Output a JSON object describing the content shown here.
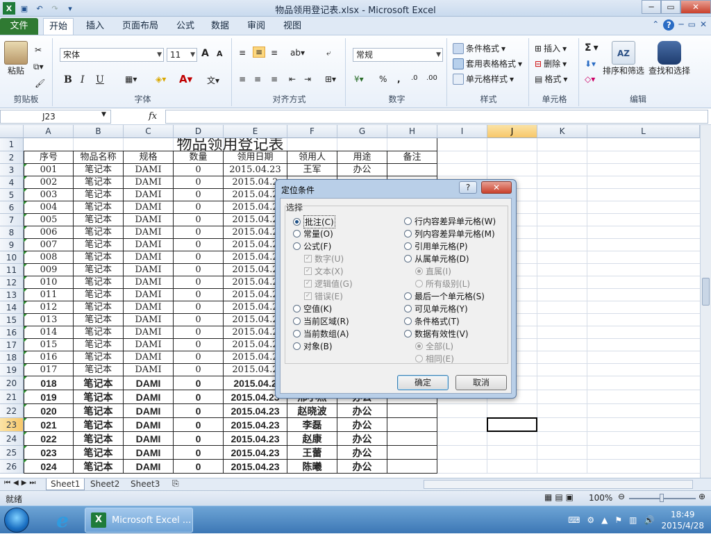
{
  "window": {
    "title": "物品领用登记表.xlsx - Microsoft Excel",
    "min": "─",
    "max": "▭",
    "close": "✕"
  },
  "tabs": [
    "文件",
    "开始",
    "插入",
    "页面布局",
    "公式",
    "数据",
    "审阅",
    "视图"
  ],
  "ribbon": {
    "clipboard": {
      "label": "剪贴板",
      "paste": "粘贴"
    },
    "font": {
      "label": "字体",
      "name": "宋体",
      "size": "11",
      "bold": "B",
      "italic": "I",
      "underline": "U",
      "grow": "A",
      "shrink": "A"
    },
    "alignment": {
      "label": "对齐方式"
    },
    "number": {
      "label": "数字",
      "format": "常规",
      "percent": "%",
      "comma": ","
    },
    "styles": {
      "label": "样式",
      "cond": "条件格式",
      "table": "套用表格格式",
      "cell": "单元格样式"
    },
    "cells": {
      "label": "单元格",
      "insert": "插入",
      "delete": "删除",
      "format": "格式"
    },
    "editing": {
      "label": "编辑",
      "sort": "排序和筛选",
      "find": "查找和选择",
      "sigma": "Σ"
    }
  },
  "namebox": "J23",
  "fx": "fx",
  "columns": [
    "A",
    "B",
    "C",
    "D",
    "E",
    "F",
    "G",
    "H",
    "I",
    "J",
    "K",
    "L"
  ],
  "sheet_title": "物品领用登记表",
  "headers": [
    "序号",
    "物品名称",
    "规格",
    "数量",
    "领用日期",
    "领用人",
    "用途",
    "备注"
  ],
  "rows_plain": [
    [
      "001",
      "笔记本",
      "DAMI",
      "0",
      "2015.04.23",
      "王军",
      "办公"
    ],
    [
      "002",
      "笔记本",
      "DAMI",
      "0",
      "2015.04.2"
    ],
    [
      "003",
      "笔记本",
      "DAMI",
      "0",
      "2015.04.2"
    ],
    [
      "004",
      "笔记本",
      "DAMI",
      "0",
      "2015.04.2"
    ],
    [
      "005",
      "笔记本",
      "DAMI",
      "0",
      "2015.04.2"
    ],
    [
      "006",
      "笔记本",
      "DAMI",
      "0",
      "2015.04.2"
    ],
    [
      "007",
      "笔记本",
      "DAMI",
      "0",
      "2015.04.2"
    ],
    [
      "008",
      "笔记本",
      "DAMI",
      "0",
      "2015.04.2"
    ],
    [
      "009",
      "笔记本",
      "DAMI",
      "0",
      "2015.04.2"
    ],
    [
      "010",
      "笔记本",
      "DAMI",
      "0",
      "2015.04.2"
    ],
    [
      "011",
      "笔记本",
      "DAMI",
      "0",
      "2015.04.2"
    ],
    [
      "012",
      "笔记本",
      "DAMI",
      "0",
      "2015.04.2"
    ],
    [
      "013",
      "笔记本",
      "DAMI",
      "0",
      "2015.04.2"
    ],
    [
      "014",
      "笔记本",
      "DAMI",
      "0",
      "2015.04.2"
    ],
    [
      "015",
      "笔记本",
      "DAMI",
      "0",
      "2015.04.2"
    ],
    [
      "016",
      "笔记本",
      "DAMI",
      "0",
      "2015.04.2"
    ],
    [
      "017",
      "笔记本",
      "DAMI",
      "0",
      "2015.04.2"
    ]
  ],
  "rows_bold": [
    [
      "018",
      "笔记本",
      "DAMI",
      "0",
      "2015.04.2"
    ],
    [
      "019",
      "笔记本",
      "DAMI",
      "0",
      "2015.04.23",
      "邢小燕",
      "办公"
    ],
    [
      "020",
      "笔记本",
      "DAMI",
      "0",
      "2015.04.23",
      "赵晓波",
      "办公"
    ],
    [
      "021",
      "笔记本",
      "DAMI",
      "0",
      "2015.04.23",
      "李磊",
      "办公"
    ],
    [
      "022",
      "笔记本",
      "DAMI",
      "0",
      "2015.04.23",
      "赵康",
      "办公"
    ],
    [
      "023",
      "笔记本",
      "DAMI",
      "0",
      "2015.04.23",
      "王蕾",
      "办公"
    ],
    [
      "024",
      "笔记本",
      "DAMI",
      "0",
      "2015.04.23",
      "陈曦",
      "办公"
    ]
  ],
  "sheets": [
    "Sheet1",
    "Sheet2",
    "Sheet3"
  ],
  "status": {
    "ready": "就绪",
    "zoom": "100%"
  },
  "taskbar": {
    "excel": "Microsoft Excel ...",
    "time": "18:49",
    "date": "2015/4/28"
  },
  "dialog": {
    "title": "定位条件",
    "help": "?",
    "group": "选择",
    "left": [
      {
        "label": "批注(C)",
        "on": true,
        "dis": false,
        "type": "radio"
      },
      {
        "label": "常量(O)",
        "on": false,
        "dis": false,
        "type": "radio"
      },
      {
        "label": "公式(F)",
        "on": false,
        "dis": false,
        "type": "radio"
      },
      {
        "label": "数字(U)",
        "on": true,
        "dis": true,
        "type": "check",
        "indent": true
      },
      {
        "label": "文本(X)",
        "on": true,
        "dis": true,
        "type": "check",
        "indent": true
      },
      {
        "label": "逻辑值(G)",
        "on": true,
        "dis": true,
        "type": "check",
        "indent": true
      },
      {
        "label": "错误(E)",
        "on": true,
        "dis": true,
        "type": "check",
        "indent": true
      },
      {
        "label": "空值(K)",
        "on": false,
        "dis": false,
        "type": "radio"
      },
      {
        "label": "当前区域(R)",
        "on": false,
        "dis": false,
        "type": "radio"
      },
      {
        "label": "当前数组(A)",
        "on": false,
        "dis": false,
        "type": "radio"
      },
      {
        "label": "对象(B)",
        "on": false,
        "dis": false,
        "type": "radio"
      }
    ],
    "right": [
      {
        "label": "行内容差异单元格(W)",
        "on": false,
        "dis": false,
        "type": "radio"
      },
      {
        "label": "列内容差异单元格(M)",
        "on": false,
        "dis": false,
        "type": "radio"
      },
      {
        "label": "引用单元格(P)",
        "on": false,
        "dis": false,
        "type": "radio"
      },
      {
        "label": "从属单元格(D)",
        "on": false,
        "dis": false,
        "type": "radio"
      },
      {
        "label": "直属(I)",
        "on": true,
        "dis": true,
        "type": "radio",
        "indent": true
      },
      {
        "label": "所有级别(L)",
        "on": false,
        "dis": true,
        "type": "radio",
        "indent": true
      },
      {
        "label": "最后一个单元格(S)",
        "on": false,
        "dis": false,
        "type": "radio"
      },
      {
        "label": "可见单元格(Y)",
        "on": false,
        "dis": false,
        "type": "radio"
      },
      {
        "label": "条件格式(T)",
        "on": false,
        "dis": false,
        "type": "radio"
      },
      {
        "label": "数据有效性(V)",
        "on": false,
        "dis": false,
        "type": "radio"
      },
      {
        "label": "全部(L)",
        "on": true,
        "dis": true,
        "type": "radio",
        "indent": true
      },
      {
        "label": "相同(E)",
        "on": false,
        "dis": true,
        "type": "radio",
        "indent": true
      }
    ],
    "ok": "确定",
    "cancel": "取消"
  }
}
